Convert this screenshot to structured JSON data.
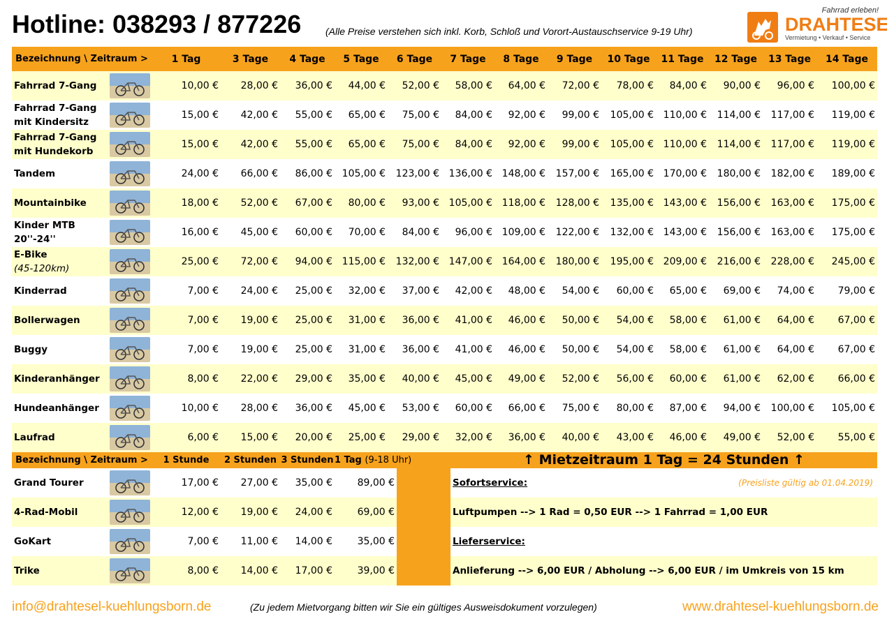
{
  "header": {
    "hotline": "Hotline: 038293 / 877226",
    "note": "(Alle Preise verstehen sich inkl. Korb, Schloß und Vorort-Austauschservice 9-19 Uhr)"
  },
  "logo": {
    "tagline": "Fahrrad erleben!",
    "name": "DRAHTESEL",
    "subline": "Vermietung • Verkauf • Service",
    "accent_color": "#f07d14"
  },
  "colors": {
    "header_bg": "#f7a21d",
    "row_alt_bg": "#ffffcc",
    "highlight_text": "#f7a21d"
  },
  "daily": {
    "label_header": "Bezeichnung \\ Zeitraum >",
    "columns": [
      "1 Tag",
      "3 Tage",
      "4 Tage",
      "5 Tage",
      "6 Tage",
      "7 Tage",
      "8 Tage",
      "9 Tage",
      "10 Tage",
      "11 Tage",
      "12 Tage",
      "13 Tage",
      "14 Tage"
    ],
    "rows": [
      {
        "name": "Fahrrad 7-Gang",
        "sub": "",
        "icon": "bicycle",
        "prices": [
          "10,00 €",
          "28,00 €",
          "36,00 €",
          "44,00 €",
          "52,00 €",
          "58,00 €",
          "64,00 €",
          "72,00 €",
          "78,00 €",
          "84,00 €",
          "90,00 €",
          "96,00 €",
          "100,00 €"
        ]
      },
      {
        "name": "Fahrrad 7-Gang mit Kindersitz",
        "sub": "",
        "icon": "bicycle-child-seat",
        "prices": [
          "15,00 €",
          "42,00 €",
          "55,00 €",
          "65,00 €",
          "75,00 €",
          "84,00 €",
          "92,00 €",
          "99,00 €",
          "105,00 €",
          "110,00 €",
          "114,00 €",
          "117,00 €",
          "119,00 €"
        ]
      },
      {
        "name": "Fahrrad 7-Gang mit Hundekorb",
        "sub": "",
        "icon": "bicycle-dog-basket",
        "prices": [
          "15,00 €",
          "42,00 €",
          "55,00 €",
          "65,00 €",
          "75,00 €",
          "84,00 €",
          "92,00 €",
          "99,00 €",
          "105,00 €",
          "110,00 €",
          "114,00 €",
          "117,00 €",
          "119,00 €"
        ]
      },
      {
        "name": "Tandem",
        "sub": "",
        "icon": "tandem",
        "prices": [
          "24,00 €",
          "66,00 €",
          "86,00 €",
          "105,00 €",
          "123,00 €",
          "136,00 €",
          "148,00 €",
          "157,00 €",
          "165,00 €",
          "170,00 €",
          "180,00 €",
          "182,00 €",
          "189,00 €"
        ]
      },
      {
        "name": "Mountainbike",
        "sub": "",
        "icon": "mountainbike",
        "prices": [
          "18,00 €",
          "52,00 €",
          "67,00 €",
          "80,00 €",
          "93,00 €",
          "105,00 €",
          "118,00 €",
          "128,00 €",
          "135,00 €",
          "143,00 €",
          "156,00 €",
          "163,00 €",
          "175,00 €"
        ]
      },
      {
        "name": "Kinder MTB 20''-24''",
        "sub": "",
        "icon": "kids-mtb",
        "prices": [
          "16,00 €",
          "45,00 €",
          "60,00 €",
          "70,00 €",
          "84,00 €",
          "96,00 €",
          "109,00 €",
          "122,00 €",
          "132,00 €",
          "143,00 €",
          "156,00 €",
          "163,00 €",
          "175,00 €"
        ]
      },
      {
        "name": "E-Bike",
        "sub": "(45-120km)",
        "icon": "e-bike",
        "prices": [
          "25,00 €",
          "72,00 €",
          "94,00 €",
          "115,00 €",
          "132,00 €",
          "147,00 €",
          "164,00 €",
          "180,00 €",
          "195,00 €",
          "209,00 €",
          "216,00 €",
          "228,00 €",
          "245,00 €"
        ]
      },
      {
        "name": "Kinderrad",
        "sub": "",
        "icon": "kids-bike",
        "prices": [
          "7,00 €",
          "24,00 €",
          "25,00 €",
          "32,00 €",
          "37,00 €",
          "42,00 €",
          "48,00 €",
          "54,00 €",
          "60,00 €",
          "65,00 €",
          "69,00 €",
          "74,00 €",
          "79,00 €"
        ]
      },
      {
        "name": "Bollerwagen",
        "sub": "",
        "icon": "handcart",
        "prices": [
          "7,00 €",
          "19,00 €",
          "25,00 €",
          "31,00 €",
          "36,00 €",
          "41,00 €",
          "46,00 €",
          "50,00 €",
          "54,00 €",
          "58,00 €",
          "61,00 €",
          "64,00 €",
          "67,00 €"
        ]
      },
      {
        "name": "Buggy",
        "sub": "",
        "icon": "buggy",
        "prices": [
          "7,00 €",
          "19,00 €",
          "25,00 €",
          "31,00 €",
          "36,00 €",
          "41,00 €",
          "46,00 €",
          "50,00 €",
          "54,00 €",
          "58,00 €",
          "61,00 €",
          "64,00 €",
          "67,00 €"
        ]
      },
      {
        "name": "Kinderanhänger",
        "sub": "",
        "icon": "child-trailer",
        "prices": [
          "8,00 €",
          "22,00 €",
          "29,00 €",
          "35,00 €",
          "40,00 €",
          "45,00 €",
          "49,00 €",
          "52,00 €",
          "56,00 €",
          "60,00 €",
          "61,00 €",
          "62,00 €",
          "66,00 €"
        ]
      },
      {
        "name": "Hundeanhänger",
        "sub": "",
        "icon": "dog-trailer",
        "prices": [
          "10,00 €",
          "28,00 €",
          "36,00 €",
          "45,00 €",
          "53,00 €",
          "60,00 €",
          "66,00 €",
          "75,00 €",
          "80,00 €",
          "87,00 €",
          "94,00 €",
          "100,00 €",
          "105,00 €"
        ]
      },
      {
        "name": "Laufrad",
        "sub": "",
        "icon": "balance-bike",
        "prices": [
          "6,00 €",
          "15,00 €",
          "20,00 €",
          "25,00 €",
          "29,00 €",
          "32,00 €",
          "36,00 €",
          "40,00 €",
          "43,00 €",
          "46,00 €",
          "49,00 €",
          "52,00 €",
          "55,00 €"
        ]
      }
    ]
  },
  "hourly": {
    "label_header": "Bezeichnung \\ Zeitraum >",
    "columns": [
      "1 Stunde",
      "2 Stunden",
      "3 Stunden",
      "1 Tag"
    ],
    "day_note": "(9-18 Uhr)",
    "rows": [
      {
        "name": "Grand Tourer",
        "icon": "grand-tourer",
        "prices": [
          "17,00 €",
          "27,00 €",
          "35,00 €",
          "89,00 €"
        ]
      },
      {
        "name": "4-Rad-Mobil",
        "icon": "four-wheel-mobile",
        "prices": [
          "12,00 €",
          "19,00 €",
          "24,00 €",
          "69,00 €"
        ]
      },
      {
        "name": "GoKart",
        "icon": "gokart",
        "prices": [
          "7,00 €",
          "11,00 €",
          "14,00 €",
          "35,00 €"
        ]
      },
      {
        "name": "Trike",
        "icon": "trike",
        "prices": [
          "8,00 €",
          "14,00 €",
          "17,00 €",
          "39,00 €"
        ]
      }
    ]
  },
  "info": {
    "rental_period": "↑ Mietzeitraum 1 Tag = 24 Stunden ↑",
    "sofortservice_title": "Sofortservice:",
    "valid_from": "(Preisliste gültig ab 01.04.2019)",
    "luftpumpen": "Luftpumpen --> 1 Rad = 0,50 EUR --> 1 Fahrrad = 1,00 EUR",
    "lieferservice_title": "Lieferservice:",
    "anlieferung": "Anlieferung --> 6,00 EUR / Abholung --> 6,00 EUR / im Umkreis von 15 km"
  },
  "footer": {
    "email": "info@drahtesel-kuehlungsborn.de",
    "id_note": "(Zu jedem Mietvorgang bitten wir Sie ein gültiges Ausweisdokument vorzulegen)",
    "website": "www.drahtesel-kuehlungsborn.de"
  }
}
